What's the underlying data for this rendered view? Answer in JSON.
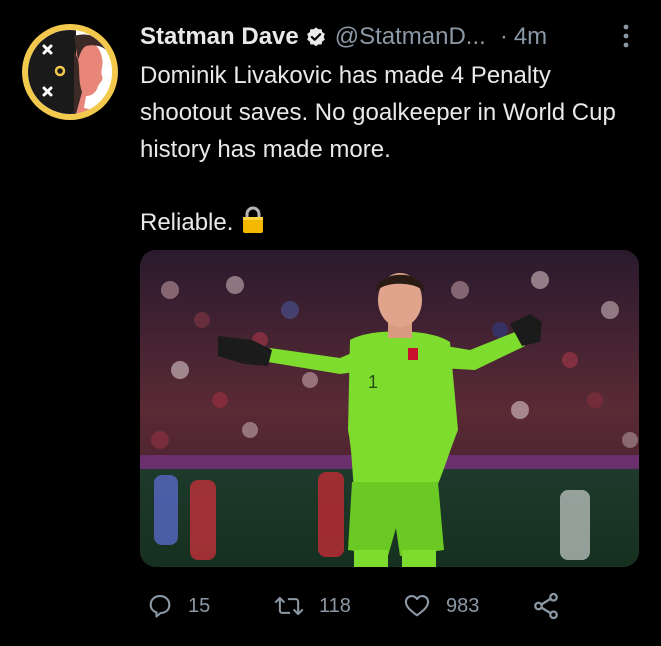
{
  "tweet": {
    "display_name": "Statman Dave",
    "handle": "@StatmanD...",
    "separator": "·",
    "time_ago": "4m",
    "text_line1": "Dominik Livakovic has made 4 Penalty shootout saves. No goalkeeper in World Cup history has made more.",
    "text_line2": "Reliable.",
    "emoji": "lock-emoji"
  },
  "stats": {
    "replies": "15",
    "retweets": "118",
    "likes": "983"
  },
  "colors": {
    "background": "#000000",
    "text": "#e7e9ea",
    "secondary": "#8b98a5",
    "avatar_ring": "#f2c94c",
    "jersey_green": "#7ddc2e"
  },
  "icons": [
    "verified-badge-icon",
    "more-options-icon",
    "reply-icon",
    "retweet-icon",
    "like-icon",
    "share-icon"
  ]
}
